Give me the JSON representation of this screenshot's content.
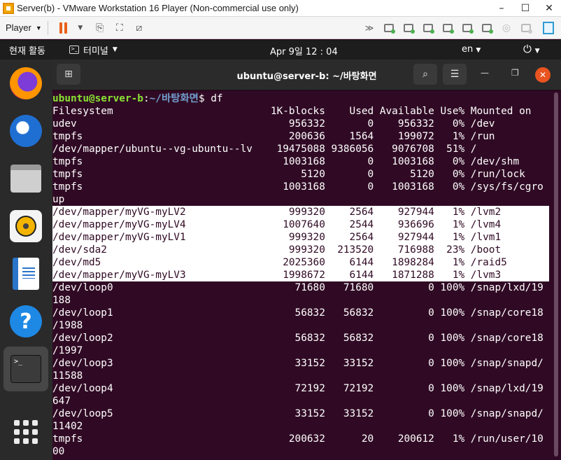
{
  "vmware": {
    "title": "Server(b) - VMware Workstation 16 Player (Non-commercial use only)",
    "player_label": "Player",
    "window_controls": [
      "–",
      "☐",
      "✕"
    ]
  },
  "gnome": {
    "activities": "현재 활동",
    "app_menu": "터미널",
    "clock": "Apr 9일  12 : 04",
    "lang": "en"
  },
  "terminal": {
    "title": "ubuntu@server-b: ~/바탕화면",
    "prompt": {
      "user": "ubuntu@server-b",
      "sep": ":",
      "path": "~/바탕화면",
      "sym": "$ ",
      "cmd": "df"
    },
    "lines": [
      "Filesystem                          1K-blocks    Used Available Use% Mounted on",
      "udev                                   956332       0    956332   0% /dev",
      "tmpfs                                  200636    1564    199072   1% /run",
      "/dev/mapper/ubuntu--vg-ubuntu--lv    19475088 9386056   9076708  51% /",
      "tmpfs                                 1003168       0   1003168   0% /dev/shm",
      "tmpfs                                    5120       0      5120   0% /run/lock",
      "tmpfs                                 1003168       0   1003168   0% /sys/fs/cgro",
      "up",
      "/dev/mapper/myVG-myLV2                 999320    2564    927944   1% /lvm2",
      "/dev/mapper/myVG-myLV4                1007640    2544    936696   1% /lvm4",
      "/dev/mapper/myVG-myLV1                 999320    2564    927944   1% /lvm1",
      "/dev/sda2                              999320  213520    716988  23% /boot",
      "/dev/md5                              2025360    6144   1898284   1% /raid5",
      "/dev/mapper/myVG-myLV3                1998672    6144   1871288   1% /lvm3",
      "/dev/loop0                              71680   71680         0 100% /snap/lxd/19",
      "188",
      "/dev/loop1                              56832   56832         0 100% /snap/core18",
      "/1988",
      "/dev/loop2                              56832   56832         0 100% /snap/core18",
      "/1997",
      "/dev/loop3                              33152   33152         0 100% /snap/snapd/",
      "11588",
      "/dev/loop4                              72192   72192         0 100% /snap/lxd/19",
      "647",
      "/dev/loop5                              33152   33152         0 100% /snap/snapd/",
      "11402",
      "tmpfs                                  200632      20    200612   1% /run/user/10",
      "00"
    ],
    "selected_lines": [
      8,
      9,
      10,
      11,
      12,
      13
    ]
  },
  "dock": {
    "icons": [
      "firefox-icon",
      "thunderbird-icon",
      "files-icon",
      "rhythmbox-icon",
      "libreoffice-writer-icon",
      "help-icon",
      "terminal-icon",
      "show-applications-icon"
    ],
    "terminal_glyph": ">_"
  },
  "colors": {
    "terminal_bg": "#300a24",
    "prompt_user": "#8ae234",
    "prompt_path": "#729fcf",
    "ubuntu_orange": "#e95420",
    "vm_pause": "#e8611a"
  }
}
